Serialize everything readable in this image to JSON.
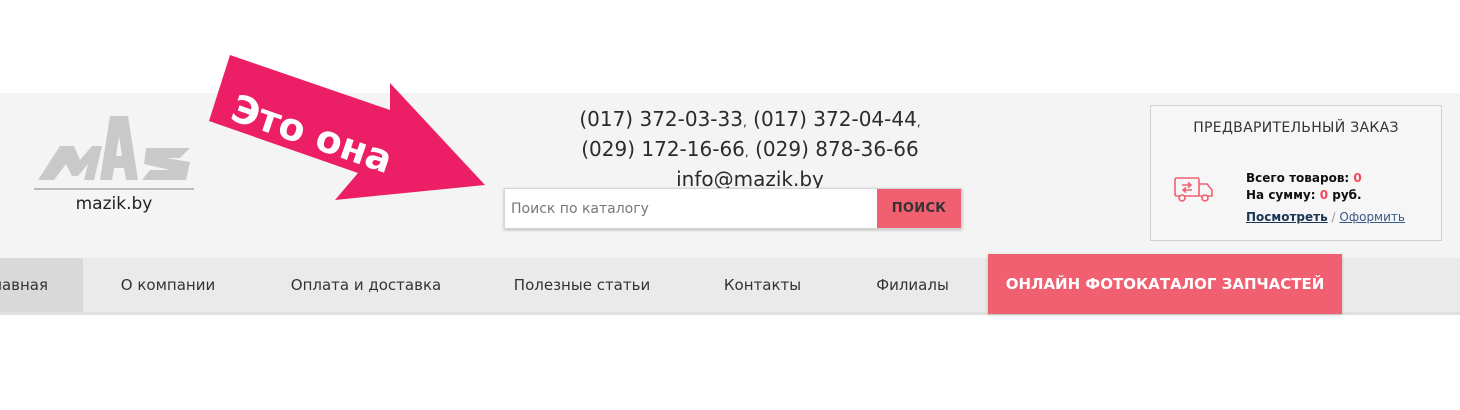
{
  "logo": {
    "text": "mazik.by",
    "icon": "maz-logo-icon"
  },
  "contacts": {
    "phone1": "(017) 372-03-33",
    "phone2": "(017) 372-04-44",
    "phone3": "(029) 172-16-66",
    "phone4": "(029) 878-36-66",
    "email": "info@mazik.by"
  },
  "search": {
    "placeholder": "Поиск по каталогу",
    "button": "ПОИСК"
  },
  "preorder": {
    "title": "ПРЕДВАРИТЕЛЬНЫЙ ЗАКАЗ",
    "items_label": "Всего товаров:",
    "items_value": "0",
    "sum_label": "На сумму:",
    "sum_value": "0",
    "sum_unit": "руб.",
    "view_link": "Посмотреть",
    "separator": "/",
    "order_link": "Оформить",
    "icon": "truck-icon"
  },
  "nav": {
    "items": [
      {
        "label": "Главная"
      },
      {
        "label": "О компании"
      },
      {
        "label": "Оплата и доставка"
      },
      {
        "label": "Полезные статьи"
      },
      {
        "label": "Контакты"
      },
      {
        "label": "Филиалы"
      }
    ],
    "cta": "ОНЛАЙН ФОТОКАТАЛОГ ЗАПЧАСТЕЙ"
  },
  "annotation": {
    "text": "Это она",
    "color": "#ec1f66"
  },
  "colors": {
    "accent": "#f06071",
    "header_bg": "#f4f4f4",
    "nav_bg": "#eaeaea"
  }
}
